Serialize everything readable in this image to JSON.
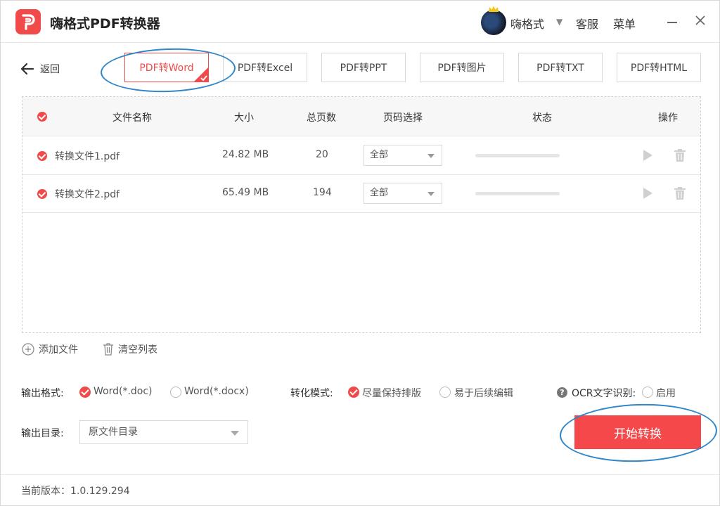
{
  "app": {
    "title": "嗨格式PDF转换器"
  },
  "header": {
    "username": "嗨格式",
    "service": "客服",
    "menu": "菜单"
  },
  "nav": {
    "back_label": "返回"
  },
  "tabs": [
    {
      "label": "PDF转Word",
      "active": true
    },
    {
      "label": "PDF转Excel",
      "active": false
    },
    {
      "label": "PDF转PPT",
      "active": false
    },
    {
      "label": "PDF转图片",
      "active": false
    },
    {
      "label": "PDF转TXT",
      "active": false
    },
    {
      "label": "PDF转HTML",
      "active": false
    }
  ],
  "table": {
    "headers": {
      "name": "文件名称",
      "size": "大小",
      "pages": "总页数",
      "page_select": "页码选择",
      "status": "状态",
      "actions": "操作"
    },
    "rows": [
      {
        "name": "转换文件1.pdf",
        "size": "24.82 MB",
        "pages": "20",
        "page_select": "全部",
        "progress": 0
      },
      {
        "name": "转换文件2.pdf",
        "size": "65.49 MB",
        "pages": "194",
        "page_select": "全部",
        "progress": 0
      }
    ]
  },
  "actions": {
    "add_file": "添加文件",
    "clear_list": "清空列表"
  },
  "options": {
    "output_format_label": "输出格式:",
    "format_doc": "Word(*.doc)",
    "format_docx": "Word(*.docx)",
    "mode_label": "转化模式:",
    "mode_keep_layout": "尽量保持排版",
    "mode_easy_edit": "易于后续编辑",
    "ocr_label": "OCR文字识别:",
    "ocr_enable": "启用",
    "output_dir_label": "输出目录:",
    "output_dir_value": "原文件目录"
  },
  "buttons": {
    "start": "开始转换"
  },
  "footer": {
    "version": "当前版本：1.0.129.294"
  },
  "colors": {
    "accent": "#f04a4a",
    "annotation": "#2f86c8"
  }
}
